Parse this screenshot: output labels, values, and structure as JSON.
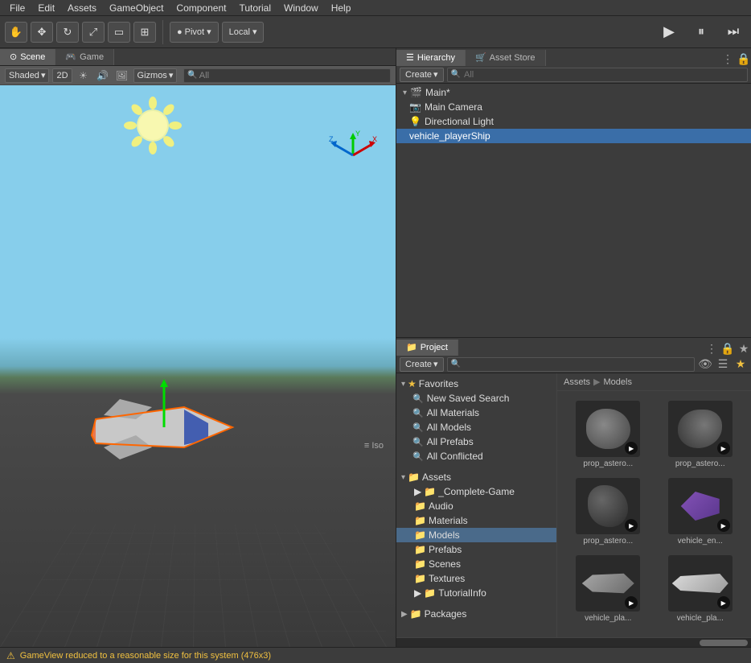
{
  "menubar": {
    "items": [
      "File",
      "Edit",
      "Assets",
      "GameObject",
      "Component",
      "Tutorial",
      "Window",
      "Help"
    ]
  },
  "toolbar": {
    "hand_tool": "✋",
    "move_tool": "✥",
    "rotate_tool": "↻",
    "scale_tool": "⤢",
    "rect_tool": "▭",
    "transform_tool": "⊞",
    "pivot_label": "Pivot",
    "local_label": "Local",
    "play_btn": "▶"
  },
  "scene": {
    "tab_label": "Scene",
    "game_tab_label": "Game",
    "shaded_label": "Shaded",
    "twod_label": "2D",
    "gizmos_label": "Gizmos",
    "all_label": "All",
    "iso_label": "≡ Iso"
  },
  "hierarchy": {
    "tab_label": "Hierarchy",
    "asset_store_tab": "Asset Store",
    "create_label": "Create",
    "search_placeholder": "All",
    "items": [
      {
        "name": "Main*",
        "type": "scene",
        "indent": 0,
        "expanded": true
      },
      {
        "name": "Main Camera",
        "type": "camera",
        "indent": 1
      },
      {
        "name": "Directional Light",
        "type": "light",
        "indent": 1
      },
      {
        "name": "vehicle_playerShip",
        "type": "object",
        "indent": 1,
        "selected": true
      }
    ]
  },
  "project": {
    "tab_label": "Project",
    "create_label": "Create",
    "search_placeholder": "",
    "breadcrumb_assets": "Assets",
    "breadcrumb_models": "Models",
    "favorites": {
      "header": "Favorites",
      "items": [
        {
          "label": "New Saved Search",
          "icon": "🔍"
        },
        {
          "label": "All Materials",
          "icon": "🔍"
        },
        {
          "label": "All Models",
          "icon": "🔍"
        },
        {
          "label": "All Prefabs",
          "icon": "🔍"
        },
        {
          "label": "All Conflicted",
          "icon": "🔍"
        }
      ]
    },
    "assets_tree": {
      "header": "Assets",
      "items": [
        {
          "label": "_Complete-Game",
          "indent": 1,
          "expanded": false
        },
        {
          "label": "Audio",
          "indent": 1
        },
        {
          "label": "Materials",
          "indent": 1
        },
        {
          "label": "Models",
          "indent": 1,
          "active": true
        },
        {
          "label": "Prefabs",
          "indent": 1
        },
        {
          "label": "Scenes",
          "indent": 1
        },
        {
          "label": "Textures",
          "indent": 1
        },
        {
          "label": "TutorialInfo",
          "indent": 1,
          "expanded": false
        }
      ]
    },
    "packages": {
      "header": "Packages",
      "indent": 0
    },
    "asset_grid": [
      {
        "label": "prop_astero...",
        "type": "asteroid1"
      },
      {
        "label": "prop_astero...",
        "type": "asteroid2"
      },
      {
        "label": "prop_astero...",
        "type": "asteroid3"
      },
      {
        "label": "vehicle_en...",
        "type": "vehicle_en"
      },
      {
        "label": "vehicle_pla...",
        "type": "vehicle_pla1"
      },
      {
        "label": "vehicle_pla...",
        "type": "vehicle_pla2"
      }
    ]
  },
  "status_bar": {
    "icon": "⚠",
    "text": "GameView reduced to a reasonable size for this system (476x3)"
  }
}
